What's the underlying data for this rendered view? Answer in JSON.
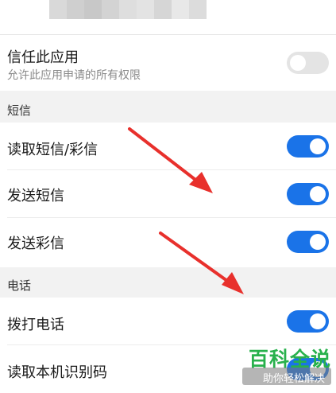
{
  "header": {
    "pixel_colors": [
      "#d9d9d9",
      "#cfcfcf",
      "#c8c8c8",
      "#d3d3d3",
      "#dedede",
      "#e3e3e3",
      "#d6d6d6",
      "#e8e8e8",
      "#dcdcdc"
    ]
  },
  "trust_app": {
    "title": "信任此应用",
    "subtitle": "允许此应用申请的所有权限",
    "enabled": false
  },
  "sections": {
    "sms": {
      "label": "短信",
      "items": [
        {
          "label": "读取短信/彩信",
          "enabled": true
        },
        {
          "label": "发送短信",
          "enabled": true
        },
        {
          "label": "发送彩信",
          "enabled": true
        }
      ]
    },
    "phone": {
      "label": "电话",
      "items": [
        {
          "label": "拨打电话",
          "enabled": true
        },
        {
          "label": "读取本机识别码",
          "enabled": true
        }
      ]
    }
  },
  "watermark": {
    "title": "百科全说",
    "subtitle": "助你轻松解决"
  },
  "colors": {
    "toggle_on": "#1a73e8",
    "toggle_off": "#e4e4e4",
    "annotation_arrow": "#e8302c",
    "watermark_green": "#28b14c"
  }
}
